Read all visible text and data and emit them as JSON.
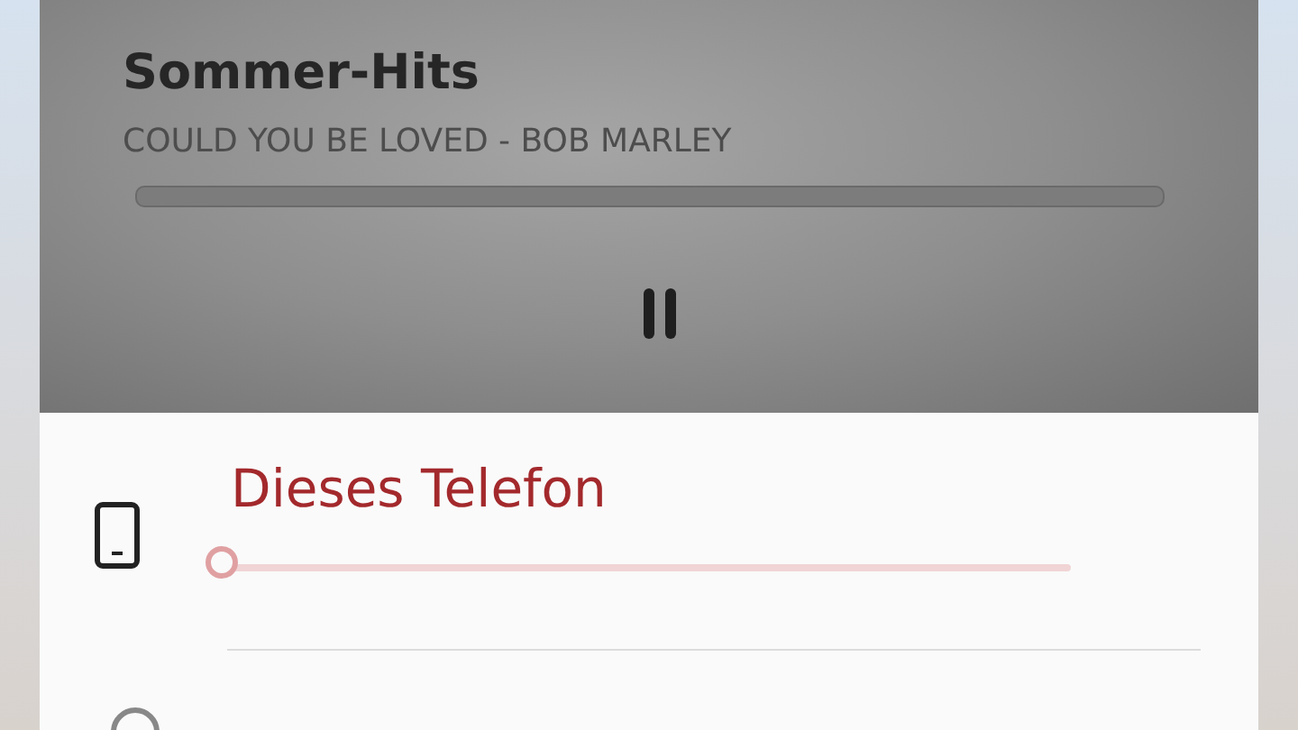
{
  "media": {
    "playlist": "Sommer-Hits",
    "track": "COULD YOU BE LOVED - BOB MARLEY",
    "progress": {
      "level": 0
    },
    "playing": true
  },
  "devices": [
    {
      "name": "Dieses Telefon",
      "kind": "phone",
      "selected": true,
      "volume": {
        "level": 0
      }
    }
  ]
}
